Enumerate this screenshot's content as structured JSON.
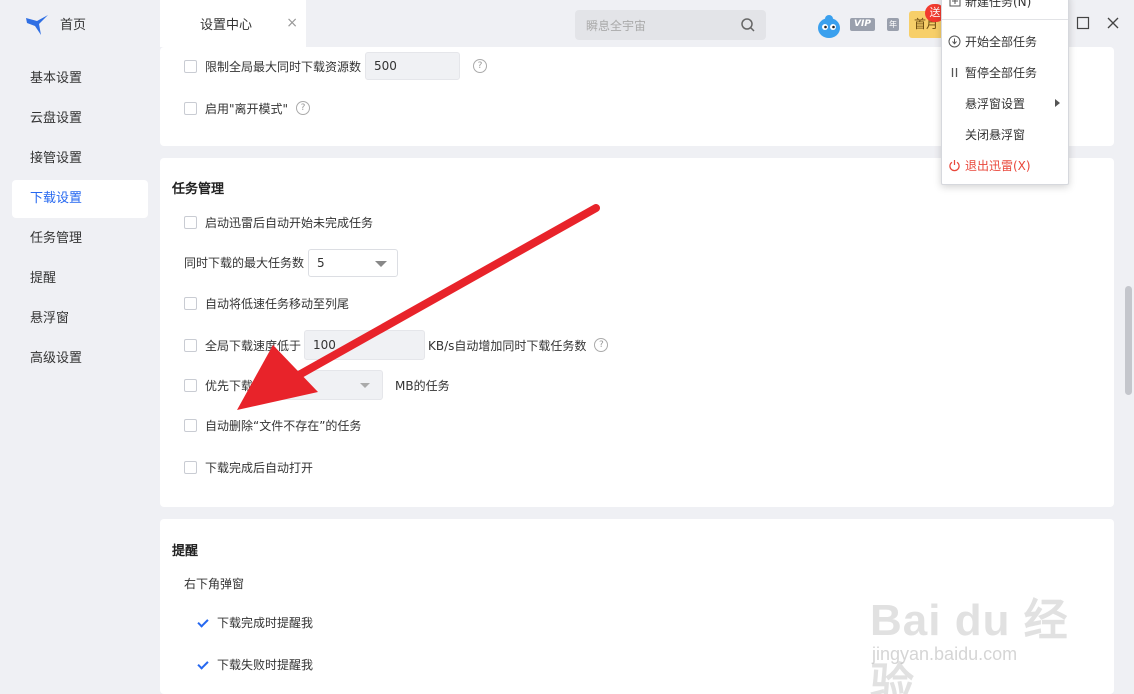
{
  "app": {
    "home_label": "首页"
  },
  "tab": {
    "title": "设置中心",
    "close": "×"
  },
  "search": {
    "placeholder": "瞬息全宇宙"
  },
  "account": {
    "vip": "VIP",
    "year": "年",
    "promo": "首月",
    "promo_badge": "送"
  },
  "sidebar": {
    "items": [
      {
        "label": "基本设置"
      },
      {
        "label": "云盘设置"
      },
      {
        "label": "接管设置"
      },
      {
        "label": "下载设置",
        "active": true
      },
      {
        "label": "任务管理"
      },
      {
        "label": "提醒"
      },
      {
        "label": "悬浮窗"
      },
      {
        "label": "高级设置"
      }
    ]
  },
  "download_card": {
    "limit_resources_label": "限制全局最大同时下载资源数",
    "limit_resources_value": "500",
    "away_mode_label": "启用\"离开模式\""
  },
  "task_card": {
    "title": "任务管理",
    "auto_start_label": "启动迅雷后自动开始未完成任务",
    "max_tasks_label": "同时下载的最大任务数",
    "max_tasks_value": "5",
    "move_slow_label": "自动将低速任务移动至列尾",
    "speed_below_label": "全局下载速度低于",
    "speed_value": "100",
    "speed_suffix": "KB/s自动增加同时下载任务数",
    "priority_label": "优先下载小",
    "priority_suffix": "MB的任务",
    "auto_delete_label": "自动删除“文件不存在”的任务",
    "auto_open_label": "下载完成后自动打开"
  },
  "remind_card": {
    "title": "提醒",
    "popup_label": "右下角弹窗",
    "complete_label": "下载完成时提醒我",
    "complete_checked": true,
    "fail_label": "下载失败时提醒我",
    "fail_checked": true
  },
  "menu": {
    "new_task": "新建任务(N)",
    "start_all": "开始全部任务",
    "pause_all": "暂停全部任务",
    "float_settings": "悬浮窗设置",
    "close_float": "关闭悬浮窗",
    "exit": "退出迅雷(X)"
  },
  "watermark": {
    "brand": "Bai du 经验",
    "url": "jingyan.baidu.com"
  },
  "colors": {
    "accent": "#2668f0",
    "annotation_arrow": "#e8232a",
    "danger": "#e9463a"
  }
}
